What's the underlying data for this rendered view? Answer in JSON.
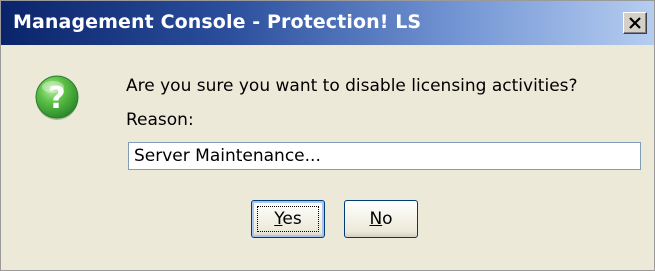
{
  "window": {
    "title": "Management Console - Protection! LS"
  },
  "dialog": {
    "icon": "question-icon",
    "message": "Are you sure you want to disable licensing activities?",
    "reason_label": "Reason:",
    "reason_value": "Server Maintenance...",
    "buttons": {
      "yes": "Yes",
      "no": "No"
    }
  },
  "colors": {
    "titlebar_start": "#0a246a",
    "titlebar_end": "#b5cdf0",
    "dialog_bg": "#ece9d8",
    "icon_green": "#3aa53a"
  }
}
